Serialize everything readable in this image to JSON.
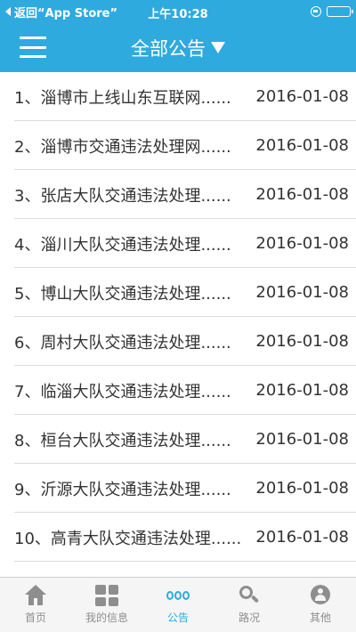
{
  "status_bar": {
    "back_label": "返回“App Store”",
    "time": "上午10:28",
    "battery_percent": 80
  },
  "nav": {
    "title": "全部公告",
    "menu_icon": "hamburger-menu-icon",
    "dropdown_icon": "triangle-down-icon"
  },
  "colors": {
    "brand": "#2faadf",
    "tab_inactive": "#8e8e8e"
  },
  "notices": [
    {
      "title": "1、淄博市上线山东互联网......",
      "date": "2016-01-08"
    },
    {
      "title": "2、淄博市交通违法处理网......",
      "date": "2016-01-08"
    },
    {
      "title": "3、张店大队交通违法处理......",
      "date": "2016-01-08"
    },
    {
      "title": "4、淄川大队交通违法处理......",
      "date": "2016-01-08"
    },
    {
      "title": "5、博山大队交通违法处理......",
      "date": "2016-01-08"
    },
    {
      "title": "6、周村大队交通违法处理......",
      "date": "2016-01-08"
    },
    {
      "title": "7、临淄大队交通违法处理......",
      "date": "2016-01-08"
    },
    {
      "title": "8、桓台大队交通违法处理......",
      "date": "2016-01-08"
    },
    {
      "title": "9、沂源大队交通违法处理......",
      "date": "2016-01-08"
    },
    {
      "title": "10、高青大队交通违法处理......",
      "date": "2016-01-08"
    }
  ],
  "tabbar": {
    "tabs": [
      {
        "label": "首页",
        "icon": "home-icon",
        "active": false
      },
      {
        "label": "我的信息",
        "icon": "grid-icon",
        "active": false
      },
      {
        "label": "公告",
        "icon": "notice-icon",
        "active": true
      },
      {
        "label": "路况",
        "icon": "search-icon",
        "active": false
      },
      {
        "label": "其他",
        "icon": "user-icon",
        "active": false
      }
    ]
  }
}
